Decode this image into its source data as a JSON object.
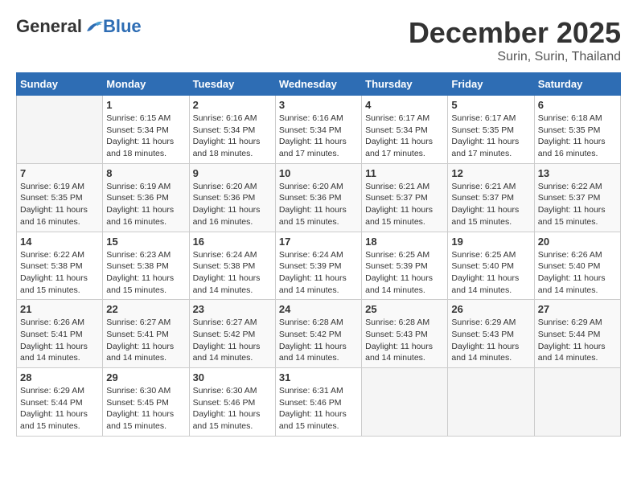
{
  "logo": {
    "general": "General",
    "blue": "Blue"
  },
  "title": {
    "month_year": "December 2025",
    "location": "Surin, Surin, Thailand"
  },
  "days_of_week": [
    "Sunday",
    "Monday",
    "Tuesday",
    "Wednesday",
    "Thursday",
    "Friday",
    "Saturday"
  ],
  "weeks": [
    [
      {
        "day": "",
        "sunrise": "",
        "sunset": "",
        "daylight": "",
        "empty": true
      },
      {
        "day": "1",
        "sunrise": "Sunrise: 6:15 AM",
        "sunset": "Sunset: 5:34 PM",
        "daylight": "Daylight: 11 hours and 18 minutes."
      },
      {
        "day": "2",
        "sunrise": "Sunrise: 6:16 AM",
        "sunset": "Sunset: 5:34 PM",
        "daylight": "Daylight: 11 hours and 18 minutes."
      },
      {
        "day": "3",
        "sunrise": "Sunrise: 6:16 AM",
        "sunset": "Sunset: 5:34 PM",
        "daylight": "Daylight: 11 hours and 17 minutes."
      },
      {
        "day": "4",
        "sunrise": "Sunrise: 6:17 AM",
        "sunset": "Sunset: 5:34 PM",
        "daylight": "Daylight: 11 hours and 17 minutes."
      },
      {
        "day": "5",
        "sunrise": "Sunrise: 6:17 AM",
        "sunset": "Sunset: 5:35 PM",
        "daylight": "Daylight: 11 hours and 17 minutes."
      },
      {
        "day": "6",
        "sunrise": "Sunrise: 6:18 AM",
        "sunset": "Sunset: 5:35 PM",
        "daylight": "Daylight: 11 hours and 16 minutes."
      }
    ],
    [
      {
        "day": "7",
        "sunrise": "Sunrise: 6:19 AM",
        "sunset": "Sunset: 5:35 PM",
        "daylight": "Daylight: 11 hours and 16 minutes."
      },
      {
        "day": "8",
        "sunrise": "Sunrise: 6:19 AM",
        "sunset": "Sunset: 5:36 PM",
        "daylight": "Daylight: 11 hours and 16 minutes."
      },
      {
        "day": "9",
        "sunrise": "Sunrise: 6:20 AM",
        "sunset": "Sunset: 5:36 PM",
        "daylight": "Daylight: 11 hours and 16 minutes."
      },
      {
        "day": "10",
        "sunrise": "Sunrise: 6:20 AM",
        "sunset": "Sunset: 5:36 PM",
        "daylight": "Daylight: 11 hours and 15 minutes."
      },
      {
        "day": "11",
        "sunrise": "Sunrise: 6:21 AM",
        "sunset": "Sunset: 5:37 PM",
        "daylight": "Daylight: 11 hours and 15 minutes."
      },
      {
        "day": "12",
        "sunrise": "Sunrise: 6:21 AM",
        "sunset": "Sunset: 5:37 PM",
        "daylight": "Daylight: 11 hours and 15 minutes."
      },
      {
        "day": "13",
        "sunrise": "Sunrise: 6:22 AM",
        "sunset": "Sunset: 5:37 PM",
        "daylight": "Daylight: 11 hours and 15 minutes."
      }
    ],
    [
      {
        "day": "14",
        "sunrise": "Sunrise: 6:22 AM",
        "sunset": "Sunset: 5:38 PM",
        "daylight": "Daylight: 11 hours and 15 minutes."
      },
      {
        "day": "15",
        "sunrise": "Sunrise: 6:23 AM",
        "sunset": "Sunset: 5:38 PM",
        "daylight": "Daylight: 11 hours and 15 minutes."
      },
      {
        "day": "16",
        "sunrise": "Sunrise: 6:24 AM",
        "sunset": "Sunset: 5:38 PM",
        "daylight": "Daylight: 11 hours and 14 minutes."
      },
      {
        "day": "17",
        "sunrise": "Sunrise: 6:24 AM",
        "sunset": "Sunset: 5:39 PM",
        "daylight": "Daylight: 11 hours and 14 minutes."
      },
      {
        "day": "18",
        "sunrise": "Sunrise: 6:25 AM",
        "sunset": "Sunset: 5:39 PM",
        "daylight": "Daylight: 11 hours and 14 minutes."
      },
      {
        "day": "19",
        "sunrise": "Sunrise: 6:25 AM",
        "sunset": "Sunset: 5:40 PM",
        "daylight": "Daylight: 11 hours and 14 minutes."
      },
      {
        "day": "20",
        "sunrise": "Sunrise: 6:26 AM",
        "sunset": "Sunset: 5:40 PM",
        "daylight": "Daylight: 11 hours and 14 minutes."
      }
    ],
    [
      {
        "day": "21",
        "sunrise": "Sunrise: 6:26 AM",
        "sunset": "Sunset: 5:41 PM",
        "daylight": "Daylight: 11 hours and 14 minutes."
      },
      {
        "day": "22",
        "sunrise": "Sunrise: 6:27 AM",
        "sunset": "Sunset: 5:41 PM",
        "daylight": "Daylight: 11 hours and 14 minutes."
      },
      {
        "day": "23",
        "sunrise": "Sunrise: 6:27 AM",
        "sunset": "Sunset: 5:42 PM",
        "daylight": "Daylight: 11 hours and 14 minutes."
      },
      {
        "day": "24",
        "sunrise": "Sunrise: 6:28 AM",
        "sunset": "Sunset: 5:42 PM",
        "daylight": "Daylight: 11 hours and 14 minutes."
      },
      {
        "day": "25",
        "sunrise": "Sunrise: 6:28 AM",
        "sunset": "Sunset: 5:43 PM",
        "daylight": "Daylight: 11 hours and 14 minutes."
      },
      {
        "day": "26",
        "sunrise": "Sunrise: 6:29 AM",
        "sunset": "Sunset: 5:43 PM",
        "daylight": "Daylight: 11 hours and 14 minutes."
      },
      {
        "day": "27",
        "sunrise": "Sunrise: 6:29 AM",
        "sunset": "Sunset: 5:44 PM",
        "daylight": "Daylight: 11 hours and 14 minutes."
      }
    ],
    [
      {
        "day": "28",
        "sunrise": "Sunrise: 6:29 AM",
        "sunset": "Sunset: 5:44 PM",
        "daylight": "Daylight: 11 hours and 15 minutes."
      },
      {
        "day": "29",
        "sunrise": "Sunrise: 6:30 AM",
        "sunset": "Sunset: 5:45 PM",
        "daylight": "Daylight: 11 hours and 15 minutes."
      },
      {
        "day": "30",
        "sunrise": "Sunrise: 6:30 AM",
        "sunset": "Sunset: 5:46 PM",
        "daylight": "Daylight: 11 hours and 15 minutes."
      },
      {
        "day": "31",
        "sunrise": "Sunrise: 6:31 AM",
        "sunset": "Sunset: 5:46 PM",
        "daylight": "Daylight: 11 hours and 15 minutes."
      },
      {
        "day": "",
        "sunrise": "",
        "sunset": "",
        "daylight": "",
        "empty": true
      },
      {
        "day": "",
        "sunrise": "",
        "sunset": "",
        "daylight": "",
        "empty": true
      },
      {
        "day": "",
        "sunrise": "",
        "sunset": "",
        "daylight": "",
        "empty": true
      }
    ]
  ]
}
